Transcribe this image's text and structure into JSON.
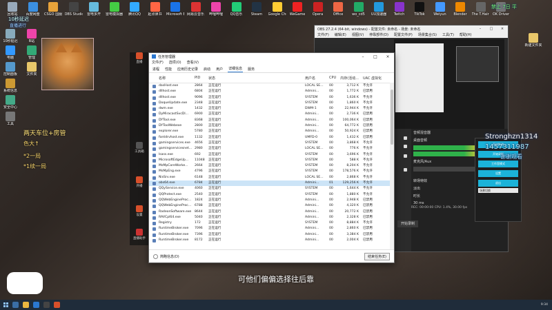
{
  "desktop": {
    "icons_row1": [
      "回收站",
      "百度网盘",
      "CSGO 国服",
      "OBS Studio",
      "雷电多开",
      "雷电模拟器",
      "腾讯QQ",
      "起点读书",
      "Microsoft Edge",
      "网易云音乐",
      "哔哩哔哩",
      "QQ音乐",
      "Steam",
      "Google Chrome",
      "WeGame",
      "Opera",
      "Office",
      "wo_cd5",
      "UU加速器",
      "Twitch",
      "TikTok",
      "Weiyun",
      "Blender",
      "The T.Hair Engineer",
      "OK Driver"
    ],
    "icons_col1": [
      "10秒延迟",
      "电脑",
      "控制面板",
      "系统信息",
      "安全中心",
      "工具"
    ],
    "icons_col2": [
      "B站",
      "管理",
      "文件夹"
    ],
    "right_icon": "新建文件夹"
  },
  "overlay": {
    "top_left_a": "10秒延迟",
    "top_left_b": "直播进行",
    "top_right": "禁止 7日 平",
    "chat_lines": [
      "两天车位+房管",
      "色大↑",
      "*2一局",
      "*1续一局"
    ],
    "fan_name": "Stronghzn1314",
    "fan_id": "1457311987",
    "fan_tag": "谢谢观看"
  },
  "live_sidebar": [
    "直播",
    "工具箱",
    "开播",
    "设置",
    "直播助手"
  ],
  "task_manager": {
    "title": "任务管理器",
    "menu": [
      "文件(F)",
      "选项(O)",
      "查看(V)"
    ],
    "tabs": [
      "进程",
      "性能",
      "应用历史记录",
      "启动",
      "用户",
      "详细信息",
      "服务"
    ],
    "active_tab": "详细信息",
    "columns": [
      "名称",
      "PID",
      "状态",
      "用户名",
      "CPU",
      "内存(活动...",
      "UAC 虚拟化"
    ],
    "rows": [
      [
        "dasHost.exe",
        "2864",
        "正在运行",
        "LOCAL SE...",
        "00",
        "3,712 K",
        "不允许"
      ],
      [
        "dllhost.exe",
        "6804",
        "正在运行",
        "Admini...",
        "00",
        "1,772 K",
        "已禁用"
      ],
      [
        "dllhost.exe",
        "9096",
        "正在运行",
        "SYSTEM",
        "00",
        "1,636 K",
        "不允许"
      ],
      [
        "DoqueUpdate.exe",
        "2348",
        "正在运行",
        "SYSTEM",
        "00",
        "1,860 K",
        "不允许"
      ],
      [
        "dwm.exe",
        "1432",
        "正在运行",
        "DWM-1",
        "00",
        "22,944 K",
        "不允许"
      ],
      [
        "DyMiracastSvcDl...",
        "6900",
        "正在运行",
        "Admini...",
        "00",
        "2,736 K",
        "已禁用"
      ],
      [
        "DYTool.exe",
        "8368",
        "正在运行",
        "Admini...",
        "00",
        "100,064 K",
        "已禁用"
      ],
      [
        "DYToolWebexe",
        "2800",
        "正在运行",
        "Admini...",
        "00",
        "64,772 K",
        "已禁用"
      ],
      [
        "explorer.exe",
        "5780",
        "正在运行",
        "Admini...",
        "00",
        "50,924 K",
        "已禁用"
      ],
      [
        "fontdrvhost.exe",
        "1132",
        "正在运行",
        "UMFD-0",
        "00",
        "1,432 K",
        "已禁用"
      ],
      [
        "gamingservices.exe",
        "4656",
        "正在运行",
        "SYSTEM",
        "00",
        "3,868 K",
        "不允许"
      ],
      [
        "gamingservicesnet...",
        "2980",
        "正在运行",
        "LOCAL SE...",
        "00",
        "776 K",
        "不允许"
      ],
      [
        "lsass.exe",
        "692",
        "正在运行",
        "SYSTEM",
        "00",
        "3,696 K",
        "不允许"
      ],
      [
        "MicrosoftEdgeUp...",
        "11048",
        "正在运行",
        "SYSTEM",
        "00",
        "588 K",
        "不允许"
      ],
      [
        "MsMpCoreWorke...",
        "2664",
        "正在运行",
        "SYSTEM",
        "00",
        "8,204 K",
        "不允许"
      ],
      [
        "MsMpEng.exe",
        "4796",
        "正在运行",
        "SYSTEM",
        "00",
        "178,576 K",
        "不允许"
      ],
      [
        "NisSrv.exe",
        "6148",
        "正在运行",
        "LOCAL SE...",
        "00",
        "2,868 K",
        "不允许"
      ],
      [
        "obs64.exe",
        "6784",
        "正在运行",
        "Admini...",
        "01",
        "129,256 K",
        "不允许"
      ],
      [
        "QQyService.exe",
        "4060",
        "正在运行",
        "SYSTEM",
        "00",
        "1,644 K",
        "不允许"
      ],
      [
        "QQProtect.exe",
        "2540",
        "正在运行",
        "SYSTEM",
        "00",
        "1,880 K",
        "不允许"
      ],
      [
        "QQWebEngineProc...",
        "1824",
        "正在运行",
        "Admini...",
        "00",
        "2,948 K",
        "已禁用"
      ],
      [
        "QQWebEngineProc...",
        "6788",
        "正在运行",
        "Admini...",
        "00",
        "4,320 K",
        "已禁用"
      ],
      [
        "RadeonSoftware.exe",
        "8644",
        "正在运行",
        "Admini...",
        "00",
        "20,772 K",
        "已禁用"
      ],
      [
        "RAVCpl64.exe",
        "5040",
        "正在运行",
        "Admini...",
        "00",
        "2,328 K",
        "已禁用"
      ],
      [
        "Registry",
        "172",
        "正在运行",
        "SYSTEM",
        "00",
        "8,884 K",
        "不允许"
      ],
      [
        "RuntimeBroker.exe",
        "7096",
        "正在运行",
        "Admini...",
        "00",
        "2,860 K",
        "已禁用"
      ],
      [
        "RuntimeBroker.exe",
        "7396",
        "正在运行",
        "Admini...",
        "00",
        "3,384 K",
        "已禁用"
      ],
      [
        "RuntimeBroker.exe",
        "8172",
        "正在运行",
        "Admini...",
        "00",
        "2,004 K",
        "已禁用"
      ]
    ],
    "selected_index": 17,
    "less_detail": "简略信息(D)",
    "end_task": "结束任务(E)"
  },
  "obs": {
    "title": "OBS 27.2.4 (64-bit, windows) - 配置文件: 未命名 - 场景: 未命名",
    "menu": [
      "文件(F)",
      "编辑(E)",
      "视图(V)",
      "停靠部件(D)",
      "配置文件(P)",
      "场景集合(S)",
      "工具(T)",
      "帮助(H)"
    ],
    "mixer_label": "音频混音器",
    "track1": "桌面音频",
    "track2": "麦克风/Aux",
    "transition_label": "转场特效",
    "transition_value": "淡出",
    "duration_label": "时长",
    "duration_value": "30 ms",
    "status": "REC: 00:00:00   CPU: 1.4%, 30.00 fps",
    "controls_btn": "开始录制"
  },
  "side_panel": {
    "buttons": [
      "开始推流",
      "开始录制",
      "工作室模式",
      "设置",
      "退出"
    ],
    "scene_label": "场景切换"
  },
  "subtitle": "可他们偏偏选择往后靠",
  "taskbar": {
    "time": "9:34",
    "date": "2022/..."
  },
  "colors": {
    "accent": "#2b78d0",
    "selected_row": "#cce4f7",
    "obs_meter_green": "#2fb24a",
    "side_blue": "#1bb3d9"
  }
}
